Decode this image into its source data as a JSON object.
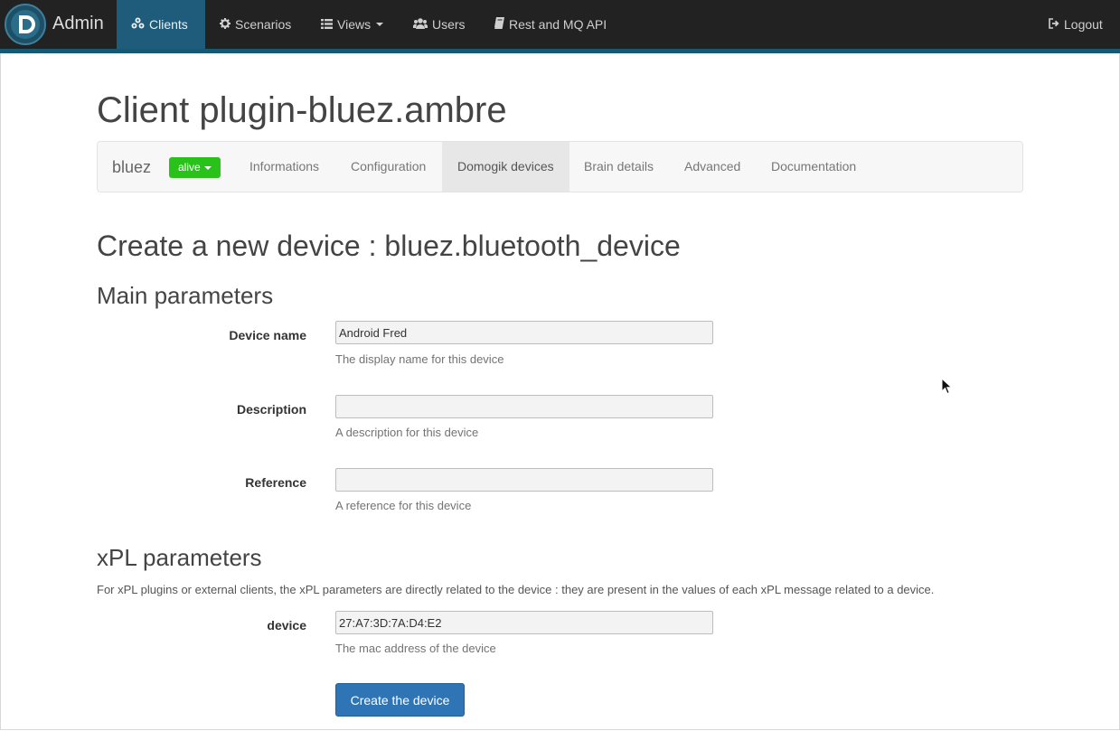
{
  "navbar": {
    "brand": "Admin",
    "items": [
      {
        "label": "Clients",
        "icon": "clients-icon"
      },
      {
        "label": "Scenarios",
        "icon": "gear-icon"
      },
      {
        "label": "Views",
        "icon": "list-icon"
      },
      {
        "label": "Users",
        "icon": "users-icon"
      },
      {
        "label": "Rest and MQ API",
        "icon": "book-icon"
      }
    ],
    "logout": "Logout",
    "colors": {
      "bar": "#222222",
      "active": "#1f5b7a",
      "accent_line": "#155a72"
    }
  },
  "page": {
    "title": "Client plugin-bluez.ambre"
  },
  "subnav": {
    "brand": "bluez",
    "status": "alive",
    "status_color": "#28c21a",
    "tabs": [
      {
        "label": "Informations"
      },
      {
        "label": "Configuration"
      },
      {
        "label": "Domogik devices"
      },
      {
        "label": "Brain details"
      },
      {
        "label": "Advanced"
      },
      {
        "label": "Documentation"
      }
    ]
  },
  "form": {
    "heading": "Create a new device : bluez.bluetooth_device",
    "main_heading": "Main parameters",
    "fields": [
      {
        "label": "Device name",
        "value": "Android Fred",
        "help": "The display name for this device"
      },
      {
        "label": "Description",
        "value": "",
        "help": "A description for this device"
      },
      {
        "label": "Reference",
        "value": "",
        "help": "A reference for this device"
      }
    ],
    "xpl_heading": "xPL parameters",
    "xpl_description": "For xPL plugins or external clients, the xPL parameters are directly related to the device : they are present in the values of each xPL message related to a device.",
    "xpl_fields": [
      {
        "label": "device",
        "value": "27:A7:3D:7A:D4:E2",
        "help": "The mac address of the device"
      }
    ],
    "submit_label": "Create the device",
    "submit_color": "#2f75b5"
  }
}
